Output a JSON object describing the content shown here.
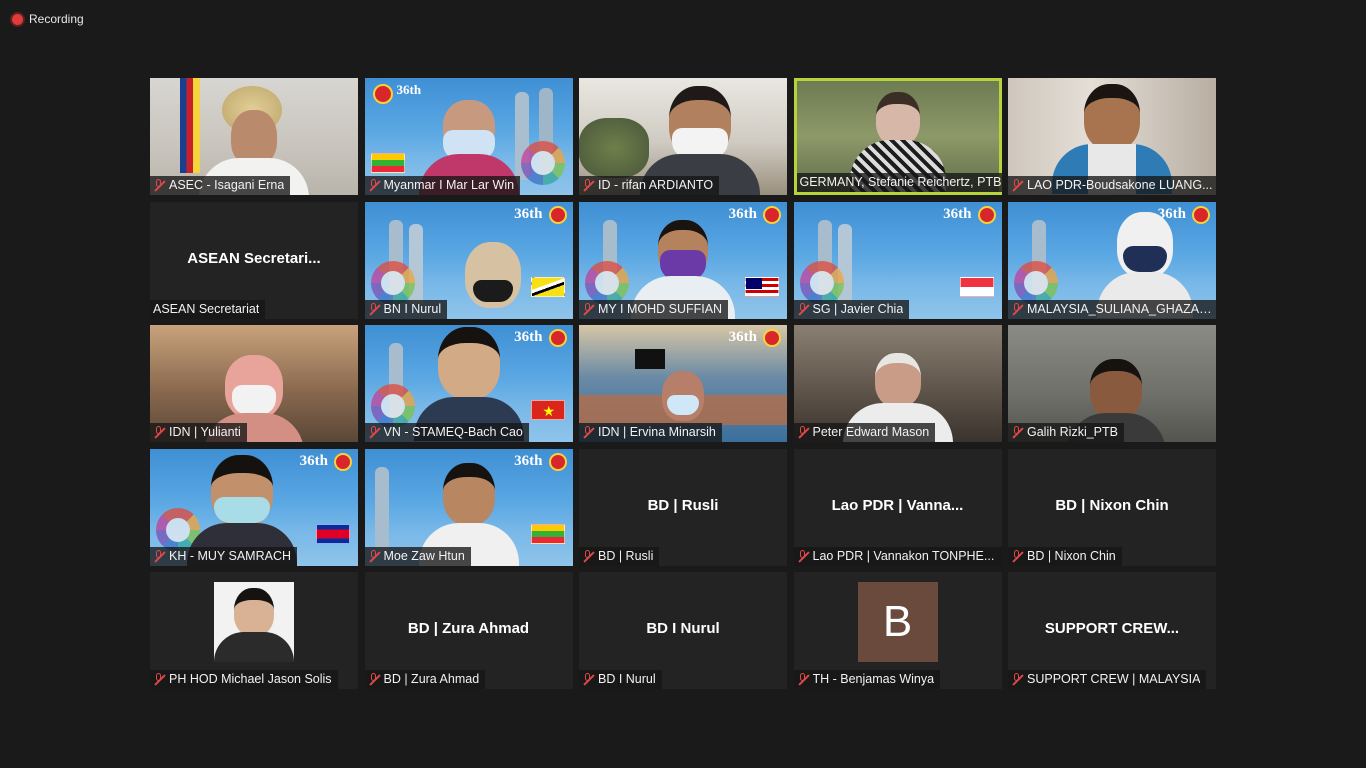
{
  "recording": {
    "label": "Recording"
  },
  "colors": {
    "active_speaker": "#b7d33a",
    "muted_mic": "#e04848",
    "tile_bg": "#232323",
    "page_bg": "#1a1a1a"
  },
  "banner": {
    "title": "36th"
  },
  "participants": [
    {
      "label": "ASEC - Isagani Erna",
      "kind": "video"
    },
    {
      "label": "Myanmar I Mar Lar Win",
      "kind": "video"
    },
    {
      "label": "ID - rifan ARDIANTO",
      "kind": "video"
    },
    {
      "label": "GERMANY, Stefanie Reichertz, PTB",
      "kind": "video",
      "active": true
    },
    {
      "label": "LAO PDR-Boudsakone LUANG...",
      "kind": "video"
    },
    {
      "label": "ASEAN Secretariat",
      "display": "ASEAN  Secretari...",
      "kind": "name"
    },
    {
      "label": "BN I Nurul",
      "kind": "video"
    },
    {
      "label": "MY I MOHD SUFFIAN",
      "kind": "video"
    },
    {
      "label": "SG | Javier Chia",
      "kind": "video"
    },
    {
      "label": "MALAYSIA_SULIANA_GHAZALL...",
      "kind": "video"
    },
    {
      "label": "IDN | Yulianti",
      "kind": "video"
    },
    {
      "label": "VN - STAMEQ-Bach Cao",
      "kind": "video"
    },
    {
      "label": "IDN | Ervina Minarsih",
      "kind": "video"
    },
    {
      "label": "Peter Edward Mason",
      "kind": "video"
    },
    {
      "label": "Galih Rizki_PTB",
      "kind": "video"
    },
    {
      "label": "KH - MUY SAMRACH",
      "kind": "video"
    },
    {
      "label": "Moe Zaw Htun",
      "kind": "video"
    },
    {
      "label": "BD | Rusli",
      "display": "BD | Rusli",
      "kind": "name"
    },
    {
      "label": "Lao PDR | Vannakon TONPHE...",
      "display": "Lao PDR | Vanna...",
      "kind": "name"
    },
    {
      "label": "BD | Nixon Chin",
      "display": "BD | Nixon Chin",
      "kind": "name"
    },
    {
      "label": "PH HOD Michael Jason Solis",
      "kind": "photo"
    },
    {
      "label": "BD | Zura Ahmad",
      "display": "BD | Zura Ahmad",
      "kind": "name"
    },
    {
      "label": "BD I Nurul",
      "display": "BD I Nurul",
      "kind": "name"
    },
    {
      "label": "TH - Benjamas Winya",
      "avatar_letter": "B",
      "kind": "avatar"
    },
    {
      "label": "SUPPORT CREW | MALAYSIA",
      "display": "SUPPORT  CREW...",
      "kind": "name"
    }
  ]
}
